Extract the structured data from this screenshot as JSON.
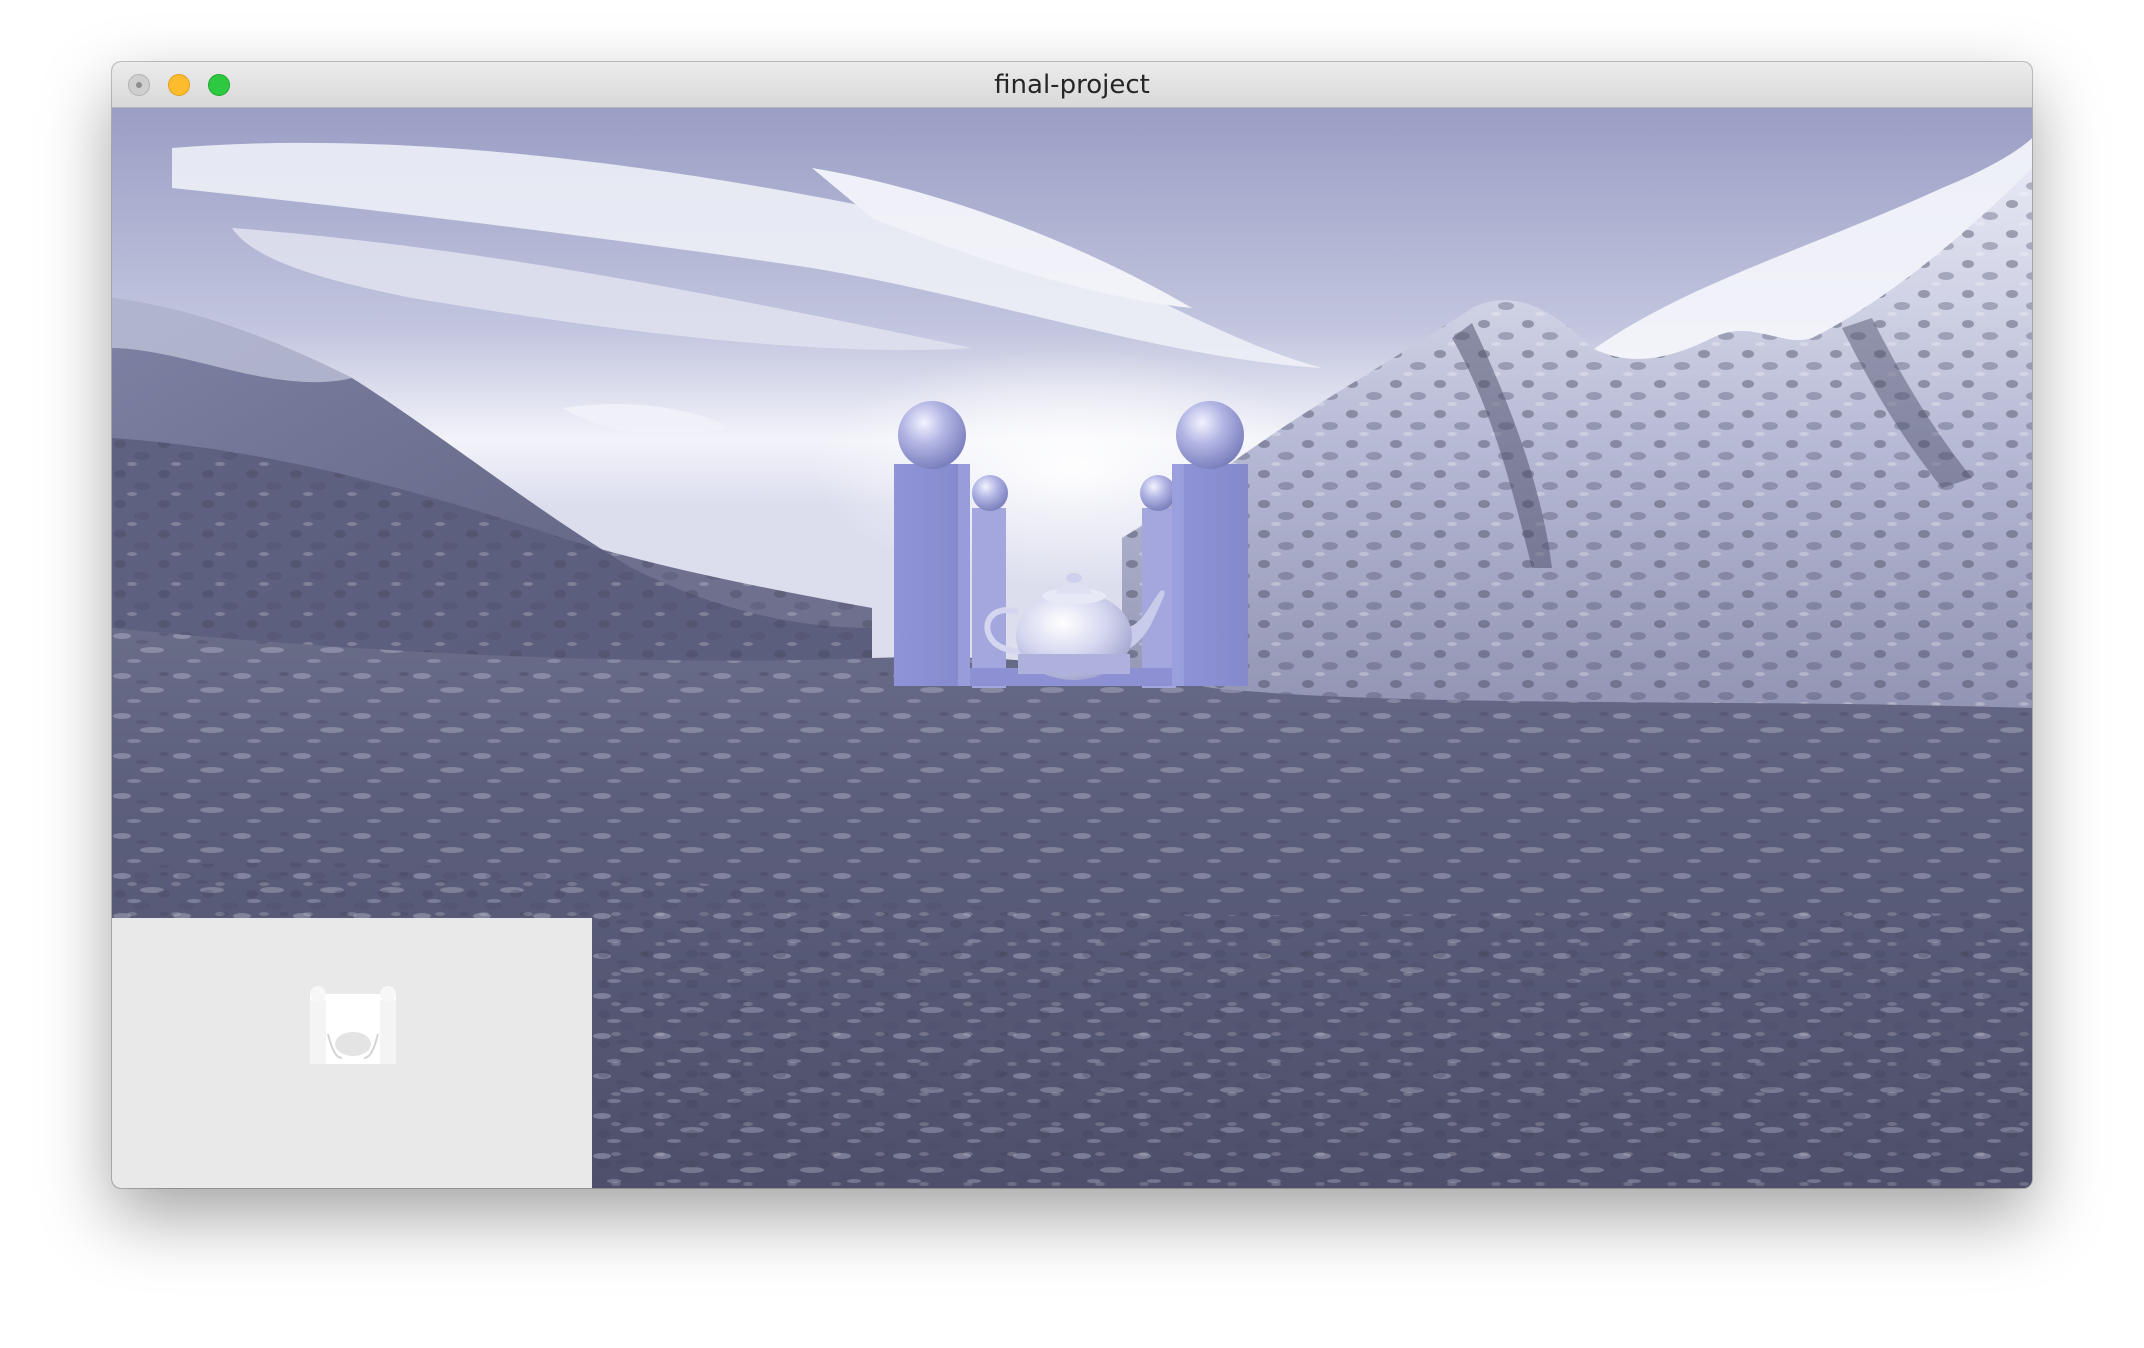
{
  "window": {
    "title": "final-project"
  },
  "colors": {
    "sky": "#b9bdd8",
    "terrain": "#5a5d7a",
    "structure": "#8e93d6",
    "minimap_bg": "#e9e9e9"
  }
}
